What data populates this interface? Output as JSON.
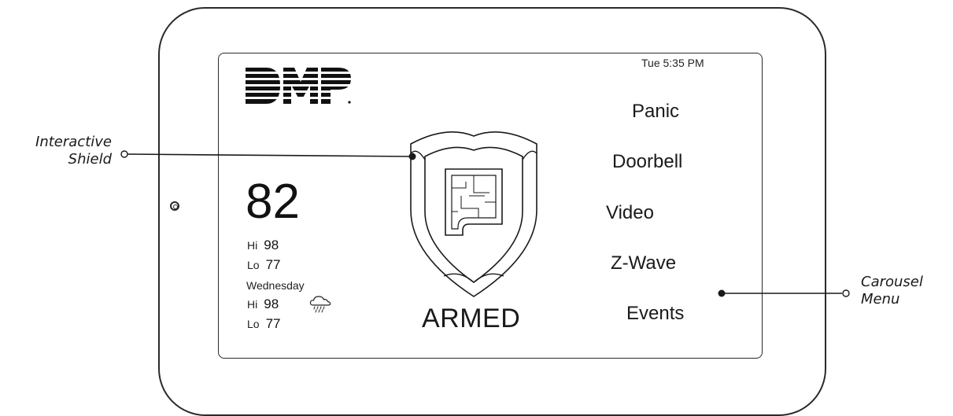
{
  "status_bar": {
    "datetime": "Tue 5:35 PM"
  },
  "logo": {
    "text": "DMP"
  },
  "weather": {
    "current_temp": "82",
    "today": {
      "hi_label": "Hi",
      "hi": "98",
      "lo_label": "Lo",
      "lo": "77"
    },
    "forecast": {
      "day": "Wednesday",
      "hi_label": "Hi",
      "hi": "98",
      "lo_label": "Lo",
      "lo": "77",
      "icon": "rain-cloud-icon"
    }
  },
  "shield": {
    "status": "ARMED",
    "icon": "floor-plan-icon"
  },
  "carousel_menu": {
    "items": [
      {
        "label": "Panic"
      },
      {
        "label": "Doorbell"
      },
      {
        "label": "Video"
      },
      {
        "label": "Z-Wave"
      },
      {
        "label": "Events"
      }
    ]
  },
  "callouts": {
    "shield": {
      "line1": "Interactive",
      "line2": "Shield"
    },
    "menu": {
      "line1": "Carousel",
      "line2": "Menu"
    }
  }
}
